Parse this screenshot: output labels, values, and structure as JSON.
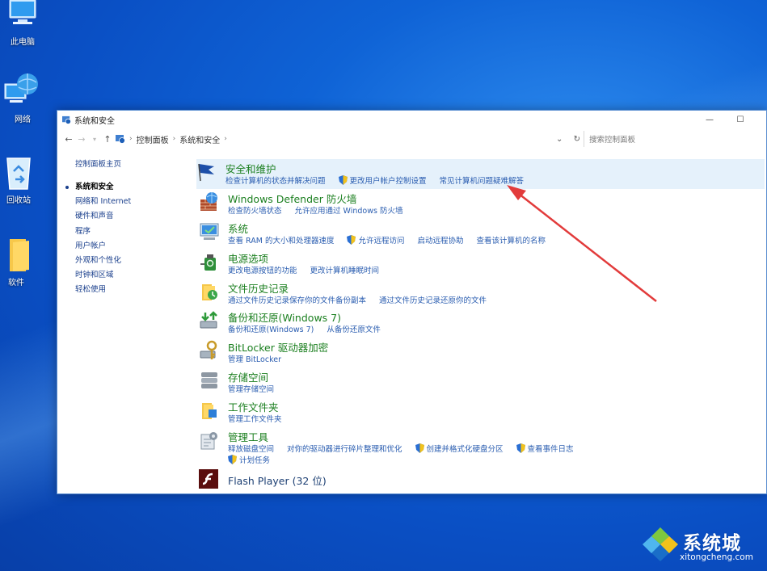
{
  "desktop": {
    "icons": [
      {
        "label": "此电脑",
        "icon": "computer-icon"
      },
      {
        "label": "网络",
        "icon": "network-icon"
      },
      {
        "label": "回收站",
        "icon": "recycle-bin-icon"
      },
      {
        "label": "软件",
        "icon": "folder-icon"
      }
    ]
  },
  "window": {
    "title": "系统和安全",
    "minimize": "—",
    "maximize": "☐",
    "breadcrumb": [
      "控制面板",
      "系统和安全"
    ],
    "search_placeholder": "搜索控制面板"
  },
  "leftnav": {
    "home": "控制面板主页",
    "items": [
      "系统和安全",
      "网络和 Internet",
      "硬件和声音",
      "程序",
      "用户帐户",
      "外观和个性化",
      "时钟和区域",
      "轻松使用"
    ]
  },
  "categories": [
    {
      "title": "安全和维护",
      "icon": "flag-icon",
      "links": [
        "检查计算机的状态并解决问题",
        "更改用户帐户控制设置",
        "常见计算机问题疑难解答"
      ]
    },
    {
      "title": "Windows Defender 防火墙",
      "icon": "firewall-icon",
      "links": [
        "检查防火墙状态",
        "允许应用通过 Windows 防火墙"
      ]
    },
    {
      "title": "系统",
      "icon": "system-icon",
      "links": [
        "查看 RAM 的大小和处理器速度",
        "允许远程访问",
        "启动远程协助",
        "查看该计算机的名称"
      ]
    },
    {
      "title": "电源选项",
      "icon": "power-icon",
      "links": [
        "更改电源按钮的功能",
        "更改计算机睡眠时间"
      ]
    },
    {
      "title": "文件历史记录",
      "icon": "file-history-icon",
      "links": [
        "通过文件历史记录保存你的文件备份副本",
        "通过文件历史记录还原你的文件"
      ]
    },
    {
      "title": "备份和还原(Windows 7)",
      "icon": "backup-icon",
      "links": [
        "备份和还原(Windows 7)",
        "从备份还原文件"
      ]
    },
    {
      "title": "BitLocker 驱动器加密",
      "icon": "bitlocker-icon",
      "links": [
        "管理 BitLocker"
      ]
    },
    {
      "title": "存储空间",
      "icon": "storage-icon",
      "links": [
        "管理存储空间"
      ]
    },
    {
      "title": "工作文件夹",
      "icon": "work-folders-icon",
      "links": [
        "管理工作文件夹"
      ]
    },
    {
      "title": "管理工具",
      "icon": "admin-tools-icon",
      "links": [
        "释放磁盘空间",
        "对你的驱动器进行碎片整理和优化",
        "创建并格式化硬盘分区",
        "查看事件日志",
        "计划任务"
      ]
    },
    {
      "title": "Flash Player (32 位)",
      "icon": "flash-icon",
      "links": []
    }
  ],
  "watermark": {
    "brand": "系统城",
    "url": "xitongcheng.com"
  },
  "colors": {
    "link": "#2a5db0",
    "category_title": "#1b7f1f",
    "annotation_arrow": "#e23b3b"
  }
}
